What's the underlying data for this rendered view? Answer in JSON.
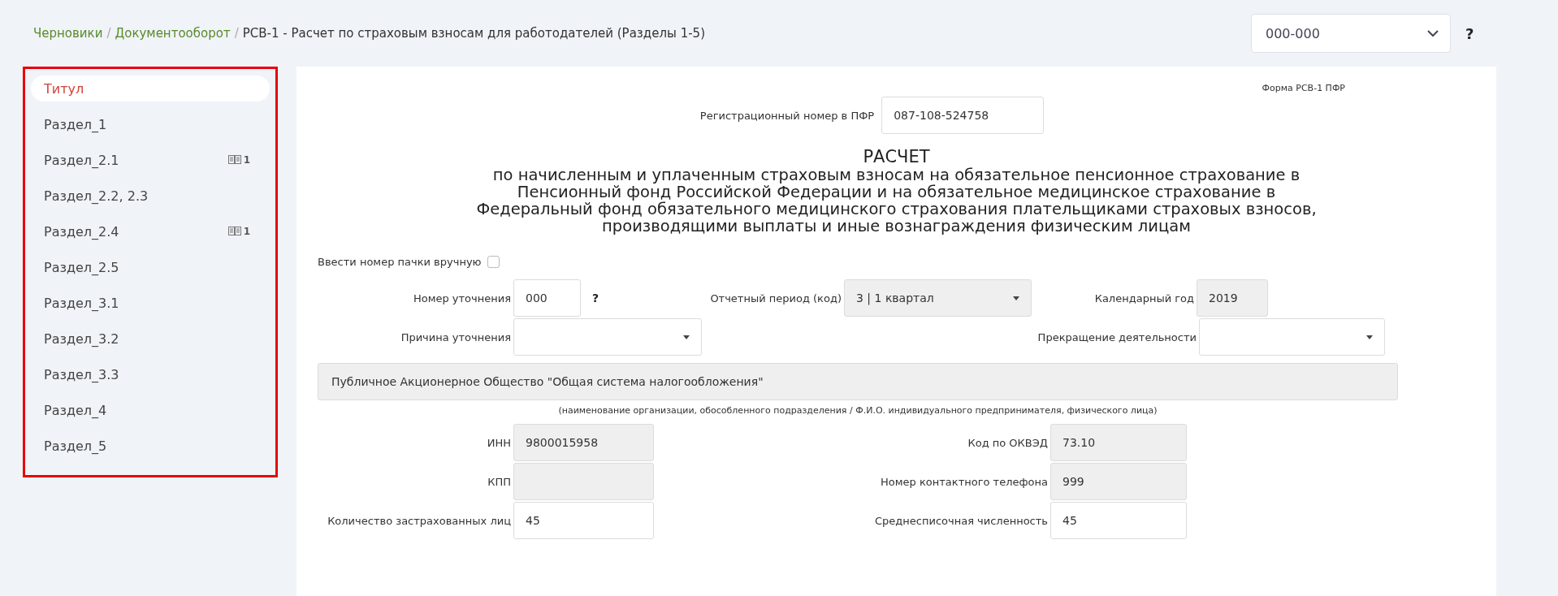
{
  "breadcrumb": {
    "links": [
      "Черновики",
      "Документооборот"
    ],
    "separator": "/",
    "current": "РСВ-1 - Расчет по страховым взносам для работодателей (Разделы 1-5)"
  },
  "version_select": {
    "value": "000-000",
    "help": "?"
  },
  "sidebar": {
    "items": [
      {
        "label": "Титул",
        "selected": true
      },
      {
        "label": "Раздел_1",
        "selected": false
      },
      {
        "label": "Раздел_2.1",
        "selected": false,
        "badge": "1"
      },
      {
        "label": "Раздел_2.2, 2.3",
        "selected": false
      },
      {
        "label": "Раздел_2.4",
        "selected": false,
        "badge": "1"
      },
      {
        "label": "Раздел_2.5",
        "selected": false
      },
      {
        "label": "Раздел_3.1",
        "selected": false
      },
      {
        "label": "Раздел_3.2",
        "selected": false
      },
      {
        "label": "Раздел_3.3",
        "selected": false
      },
      {
        "label": "Раздел_4",
        "selected": false
      },
      {
        "label": "Раздел_5",
        "selected": false
      }
    ]
  },
  "form": {
    "form_name": "Форма РСВ-1 ПФР",
    "reg_number": {
      "label": "Регистрационный номер в ПФР",
      "value": "087-108-524758"
    },
    "title": "РАСЧЕТ",
    "subtitle_lines": [
      "по начисленным и уплаченным страховым взносам на обязательное пенсионное страхование в",
      "Пенсионный фонд Российской Федерации и на обязательное медицинское страхование в",
      "Федеральный фонд обязательного медицинского страхования плательщиками страховых взносов,",
      "производящими выплаты и иные вознаграждения физическим лицам"
    ],
    "manual_pack": {
      "label": "Ввести номер пачки вручную",
      "checked": false
    },
    "correction_number": {
      "label": "Номер уточнения",
      "value": "000",
      "help": "?"
    },
    "period": {
      "label": "Отчетный период (код)",
      "value": "3 | 1 квартал",
      "disabled": true
    },
    "year": {
      "label": "Календарный год",
      "value": "2019",
      "disabled": true
    },
    "correction_reason": {
      "label": "Причина уточнения"
    },
    "termination": {
      "label": "Прекращение деятельности"
    },
    "org_name": {
      "value": "Публичное Акционерное Общество \"Общая система налогообложения\"",
      "disabled": true
    },
    "org_caption": "(наименование организации, обособленного подразделения / Ф.И.О. индивидуального предпринимателя, физического лица)",
    "field_rows": [
      {
        "left": {
          "label": "ИНН",
          "value": "9800015958",
          "disabled": true
        },
        "right": {
          "label": "Код по ОКВЭД",
          "value": "73.10",
          "disabled": true
        }
      },
      {
        "left": {
          "label": "КПП",
          "disabled": true
        },
        "right": {
          "label": "Номер контактного телефона",
          "value": "999",
          "disabled": true
        }
      },
      {
        "left": {
          "label": "Количество застрахованных лиц",
          "value": "45",
          "disabled": false
        },
        "right": {
          "label": "Среднесписочная численность",
          "value": "45",
          "disabled": false
        }
      }
    ]
  }
}
